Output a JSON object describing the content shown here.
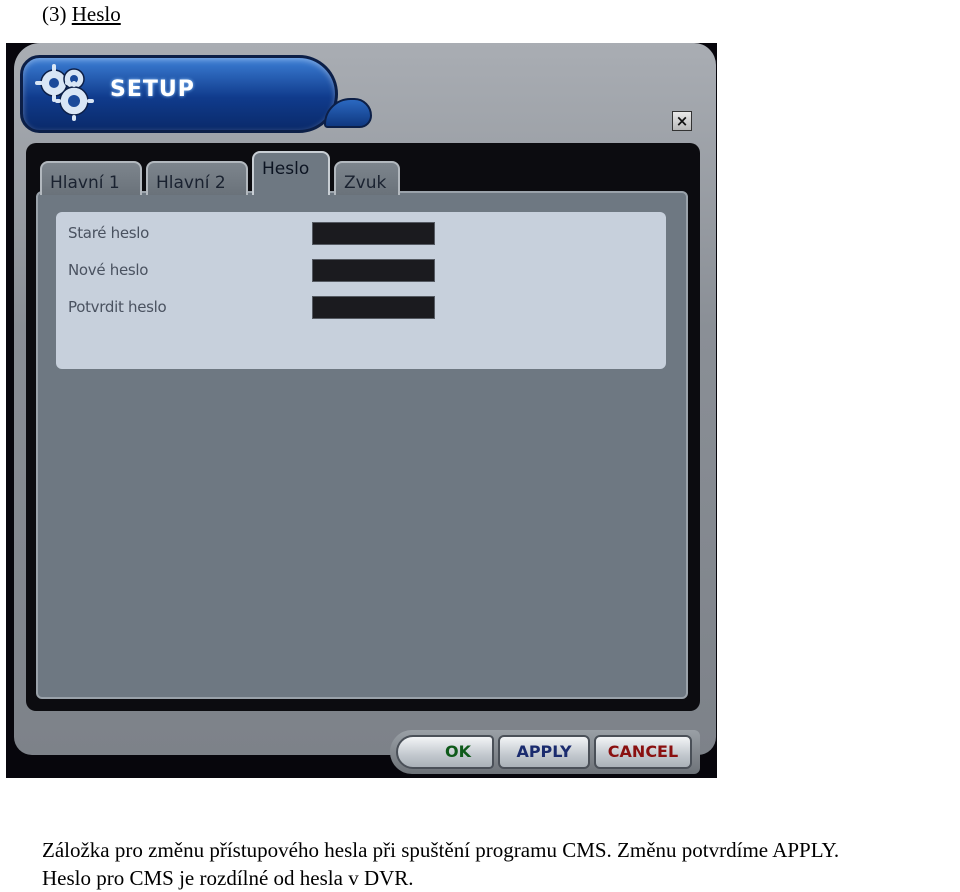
{
  "heading": {
    "number": "(3)",
    "title": "Heslo"
  },
  "window": {
    "title": "SETUP",
    "close_symbol": "×",
    "tabs": [
      {
        "label": "Hlavní 1"
      },
      {
        "label": "Hlavní 2"
      },
      {
        "label": "Heslo",
        "active": true
      },
      {
        "label": "Zvuk"
      }
    ],
    "fields": [
      {
        "label": "Staré heslo",
        "value": ""
      },
      {
        "label": "Nové heslo",
        "value": ""
      },
      {
        "label": "Potvrdit heslo",
        "value": ""
      }
    ],
    "buttons": {
      "ok": "OK",
      "apply": "APPLY",
      "cancel": "CANCEL"
    },
    "colors": {
      "header_blue": "#103b8c",
      "panel": "#6e7882",
      "form": "#c7d0dc",
      "ok": "#0e5a1a",
      "apply": "#1a2b6e",
      "cancel": "#8a1010"
    },
    "icons": {
      "logo": "gears-icon",
      "close": "close-icon"
    }
  },
  "caption": {
    "line1": "Záložka pro změnu přístupového hesla při spuštění programu CMS. Změnu potvrdíme APPLY.",
    "line2": "Heslo pro CMS je rozdílné od hesla v DVR."
  }
}
